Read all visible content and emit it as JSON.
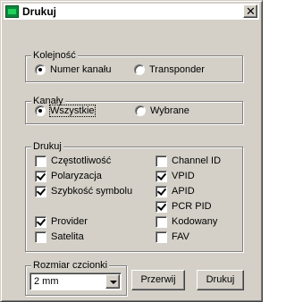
{
  "window": {
    "title": "Drukuj",
    "close_glyph": "✕",
    "icon": "app-icon"
  },
  "kolejnosc": {
    "legend": "Kolejność",
    "options": [
      {
        "label": "Numer kanału",
        "checked": true
      },
      {
        "label": "Transponder",
        "checked": false
      }
    ]
  },
  "kanaly": {
    "legend": "Kanały",
    "options": [
      {
        "label": "Wszystkie",
        "checked": true
      },
      {
        "label": "Wybrane",
        "checked": false
      }
    ]
  },
  "drukuj": {
    "legend": "Drukuj",
    "left": [
      {
        "label": "Częstotliwość",
        "checked": false
      },
      {
        "label": "Polaryzacja",
        "checked": true
      },
      {
        "label": "Szybkość symbolu",
        "checked": true
      },
      {
        "label": "Provider",
        "checked": true
      },
      {
        "label": "Satelita",
        "checked": false
      }
    ],
    "right": [
      {
        "label": "Channel ID",
        "checked": false
      },
      {
        "label": "VPID",
        "checked": true
      },
      {
        "label": "APID",
        "checked": true
      },
      {
        "label": "PCR PID",
        "checked": true
      },
      {
        "label": "Kodowany",
        "checked": false
      },
      {
        "label": "FAV",
        "checked": false
      }
    ]
  },
  "font_size": {
    "legend": "Rozmiar czcionki",
    "selected": "2 mm"
  },
  "buttons": {
    "cancel": "Przerwij",
    "print": "Drukuj"
  }
}
